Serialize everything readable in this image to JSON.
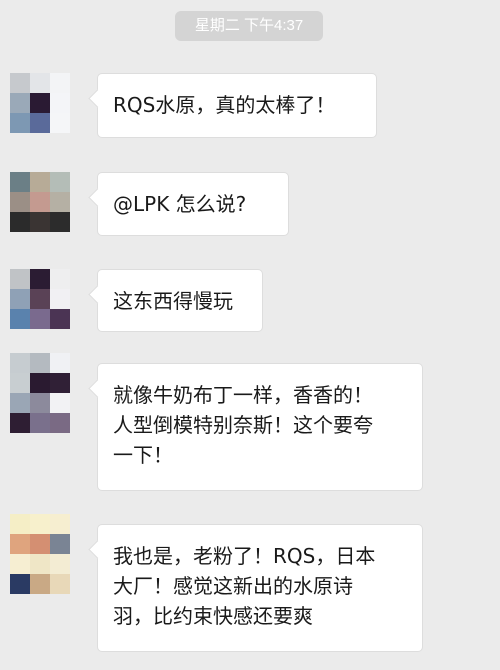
{
  "chat": {
    "timestamp": "星期二 下午4:37",
    "messages": [
      {
        "text": "RQS水原，真的太棒了！",
        "avatar": [
          "#c6c9cd",
          "#e3e5e8",
          "#f3f4f6",
          "#9aa9b8",
          "#2a1a33",
          "#f4f5f8",
          "#7d98b3",
          "#5a6a9a",
          "#f5f6f8"
        ]
      },
      {
        "text": "@LPK 怎么说?",
        "avatar": [
          "#6b7f86",
          "#b7ab97",
          "#b4bdb7",
          "#9b8f86",
          "#c49a90",
          "#b5b0a4",
          "#2b2b2b",
          "#3a3433",
          "#2c2c2c"
        ]
      },
      {
        "text": "这东西得慢玩",
        "avatar": [
          "#c0c3c6",
          "#2b1c33",
          "#eeeeef",
          "#8fa1b6",
          "#5a4256",
          "#f1f0f3",
          "#5a82ad",
          "#7a6a8e",
          "#4b3454"
        ]
      },
      {
        "text": "就像牛奶布丁一样，香香的！\n人型倒模特别奈斯！这个要夸\n一下！",
        "avatar": [
          "#c6ccd0",
          "#b4bac0",
          "#f0f1f4",
          "#c8ced1",
          "#2a1a30",
          "#302036",
          "#9aa6b5",
          "#8c8a9c",
          "#f2f2f4",
          "#2e1e33",
          "#7a708c",
          "#7a6a84"
        ]
      },
      {
        "text": "我也是，老粉了！RQS，日本\n大厂！感觉这新出的水原诗\n羽，比约束快感还要爽",
        "avatar": [
          "#f5eec6",
          "#f7f0cc",
          "#f6eed0",
          "#dfa47e",
          "#d48f72",
          "#7a8494",
          "#f6eed2",
          "#efe6c6",
          "#f3ecd3",
          "#2a3a63",
          "#c9a985",
          "#e8d8b8"
        ]
      }
    ]
  }
}
